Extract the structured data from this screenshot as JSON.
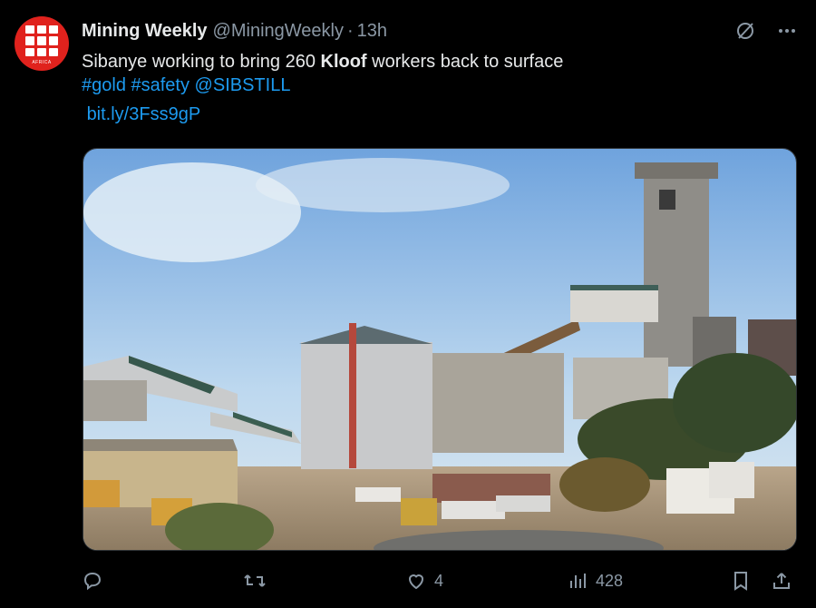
{
  "tweet": {
    "author_name": "Mining Weekly",
    "handle": "@MiningWeekly",
    "separator": "·",
    "time": "13h",
    "avatar_label": "AFRICA",
    "text_pre": "Sibanye working to bring 260 ",
    "text_bold": "Kloof",
    "text_post": " workers back to surface",
    "hashtags": [
      "#gold",
      "#safety"
    ],
    "mention": "@SIBSTILL",
    "url": "bit.ly/3Fss9gP"
  },
  "header_icons": [
    "grok-slash-icon",
    "more-icon"
  ],
  "actions": {
    "reply_count": "",
    "retweet_count": "",
    "like_count": "4",
    "views_count": "428"
  },
  "colors": {
    "background": "#000000",
    "text": "#e7e9ea",
    "muted": "#8b98a5",
    "link": "#1d9bf0",
    "avatar_red": "#e0221d"
  }
}
